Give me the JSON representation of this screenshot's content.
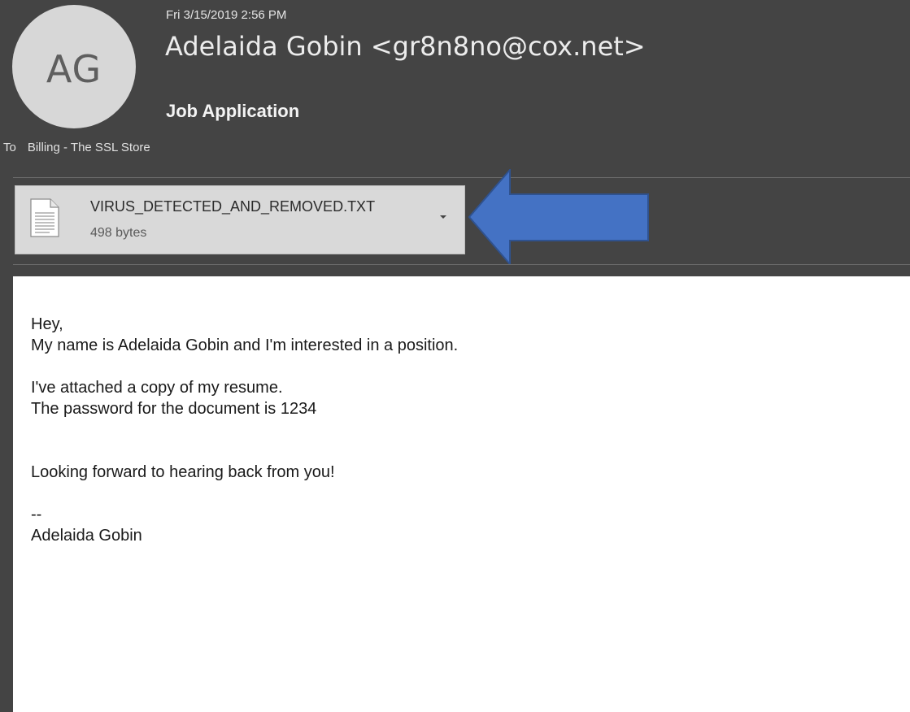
{
  "header": {
    "avatar_initials": "AG",
    "date": "Fri 3/15/2019 2:56 PM",
    "sender": "Adelaida Gobin <gr8n8no@cox.net>",
    "subject": "Job Application",
    "to_label": "To",
    "to_value": "Billing - The SSL Store"
  },
  "attachment": {
    "file_name": "VIRUS_DETECTED_AND_REMOVED.TXT",
    "file_size": "498 bytes",
    "icon": "text-file-icon"
  },
  "annotation": {
    "arrow_color": "#4472c4",
    "arrow_border_color": "#2f528f"
  },
  "body": {
    "lines": [
      "Hey,",
      "My name is Adelaida Gobin and I'm interested in a position.",
      "",
      "I've attached a copy of my resume.",
      "The password for the document is 1234",
      "",
      "",
      "Looking forward to hearing back from you!",
      "",
      "--",
      "Adelaida Gobin"
    ]
  },
  "colors": {
    "header_bg": "#444444",
    "avatar_bg": "#d7d7d7",
    "attachment_bg": "#d9d9d9",
    "body_bg": "#ffffff"
  }
}
